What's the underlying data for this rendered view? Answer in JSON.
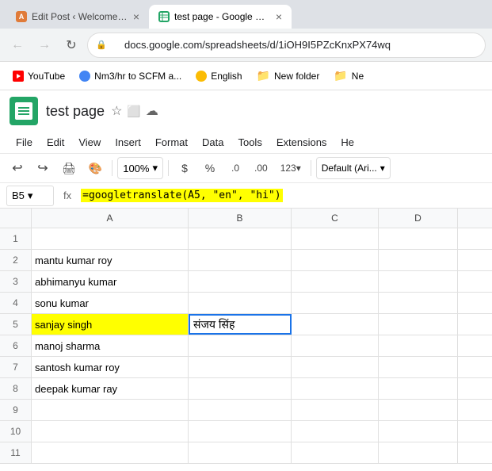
{
  "browser": {
    "tabs": [
      {
        "id": "tab1",
        "favicon": "A",
        "title": "Edit Post ‹ Welcome to Abhi's Bl...",
        "active": false,
        "favicon_color": "#e07b39"
      },
      {
        "id": "tab2",
        "favicon": "S",
        "title": "test page - Google Sheets",
        "active": true,
        "favicon_color": "#23a566"
      }
    ],
    "address": "docs.google.com/spreadsheets/d/1iOH9I5PZcKnxPX74wq",
    "bookmarks": [
      {
        "id": "yt",
        "label": "YouTube",
        "type": "yt"
      },
      {
        "id": "globe1",
        "label": "Nm3/hr to SCFM a...",
        "type": "globe"
      },
      {
        "id": "english",
        "label": "English",
        "type": "globe"
      },
      {
        "id": "folder1",
        "label": "New folder",
        "type": "folder"
      },
      {
        "id": "folder2",
        "label": "Ne",
        "type": "folder"
      }
    ]
  },
  "sheets": {
    "title": "test page",
    "menu": [
      "File",
      "Edit",
      "View",
      "Insert",
      "Format",
      "Data",
      "Tools",
      "Extensions",
      "He"
    ],
    "toolbar": {
      "zoom": "100%",
      "currency": "$",
      "percent": "%",
      "decimal1": ".0",
      "decimal2": ".00",
      "more_formats": "123",
      "font": "Default (Ari..."
    },
    "formula_bar": {
      "cell_ref": "B5",
      "formula": "=googletranslate(A5, \"en\", \"hi\")"
    },
    "columns": [
      "A",
      "B",
      "C",
      "D"
    ],
    "rows": [
      {
        "num": "1",
        "a": "",
        "b": "",
        "c": "",
        "d": ""
      },
      {
        "num": "2",
        "a": "mantu kumar roy",
        "b": "",
        "c": "",
        "d": ""
      },
      {
        "num": "3",
        "a": "abhimanyu kumar",
        "b": "",
        "c": "",
        "d": ""
      },
      {
        "num": "4",
        "a": "sonu kumar",
        "b": "",
        "c": "",
        "d": ""
      },
      {
        "num": "5",
        "a": "sanjay singh",
        "b": "संजय सिंह",
        "c": "",
        "d": ""
      },
      {
        "num": "6",
        "a": "manoj sharma",
        "b": "",
        "c": "",
        "d": ""
      },
      {
        "num": "7",
        "a": "santosh kumar roy",
        "b": "",
        "c": "",
        "d": ""
      },
      {
        "num": "8",
        "a": "deepak kumar ray",
        "b": "",
        "c": "",
        "d": ""
      },
      {
        "num": "9",
        "a": "",
        "b": "",
        "c": "",
        "d": ""
      },
      {
        "num": "10",
        "a": "",
        "b": "",
        "c": "",
        "d": ""
      },
      {
        "num": "11",
        "a": "",
        "b": "",
        "c": "",
        "d": ""
      }
    ]
  }
}
